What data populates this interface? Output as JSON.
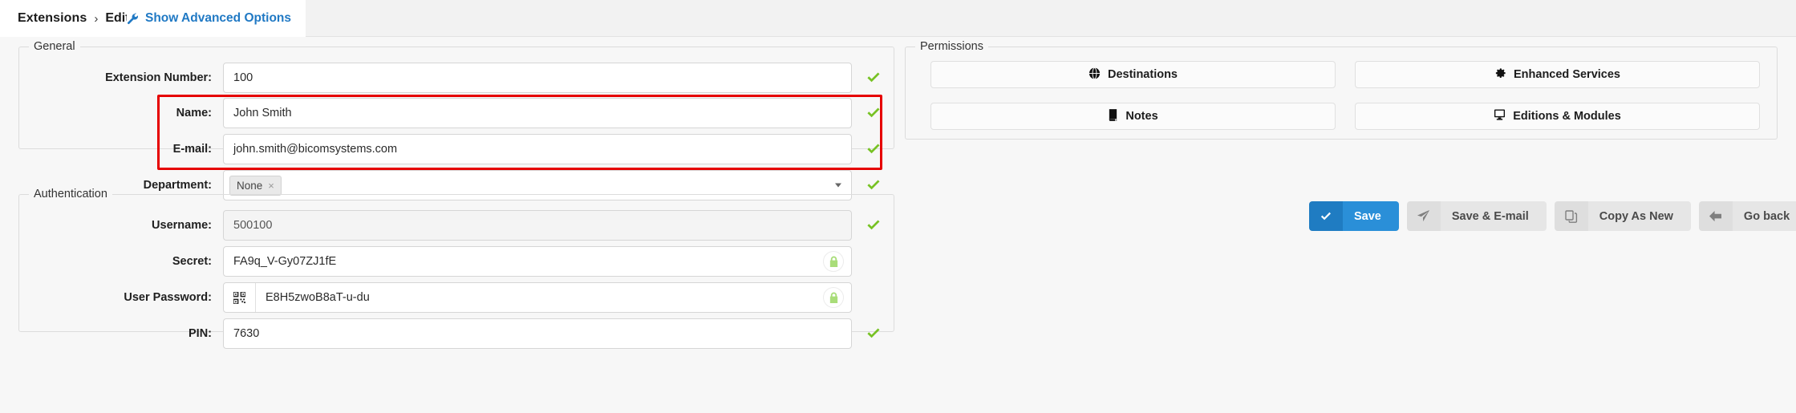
{
  "header": {
    "breadcrumb_root": "Extensions",
    "breadcrumb_sep": "›",
    "breadcrumb_leaf": "Edit",
    "advanced_link": "Show Advanced Options",
    "link_color": "#2079c4"
  },
  "general": {
    "legend": "General",
    "rows": [
      {
        "label": "Extension Number:",
        "value": "100",
        "status": "valid"
      },
      {
        "label": "Name:",
        "value": "John Smith",
        "status": "valid"
      },
      {
        "label": "E-mail:",
        "value": "john.smith@bicomsystems.com",
        "status": "valid"
      },
      {
        "label": "Department:",
        "value": "",
        "tag": "None",
        "tag_remove": "×",
        "status": "valid"
      }
    ]
  },
  "authentication": {
    "legend": "Authentication",
    "rows": [
      {
        "label": "Username:",
        "value": "500100",
        "status": "valid",
        "readonly": true
      },
      {
        "label": "Secret:",
        "value": "FA9q_V-Gy07ZJ1fE",
        "status": "locked"
      },
      {
        "label": "User Password:",
        "value": "E8H5zwoB8aT-u-du",
        "status": "locked",
        "addon": "qr-code-icon"
      },
      {
        "label": "PIN:",
        "value": "7630",
        "status": "valid"
      }
    ]
  },
  "permissions": {
    "legend": "Permissions",
    "buttons": [
      {
        "label": "Destinations",
        "icon": "globe-icon"
      },
      {
        "label": "Enhanced Services",
        "icon": "gear-icon"
      },
      {
        "label": "Notes",
        "icon": "book-icon"
      },
      {
        "label": "Editions & Modules",
        "icon": "monitor-icon"
      }
    ]
  },
  "actions": [
    {
      "label": "Save",
      "icon": "check-icon",
      "style": "primary"
    },
    {
      "label": "Save & E-mail",
      "icon": "paper-plane-icon",
      "style": "ghost"
    },
    {
      "label": "Copy As New",
      "icon": "copy-icon",
      "style": "ghost"
    },
    {
      "label": "Go back",
      "icon": "arrow-left-icon",
      "style": "ghost"
    }
  ],
  "highlight": {
    "color": "#e60000"
  }
}
